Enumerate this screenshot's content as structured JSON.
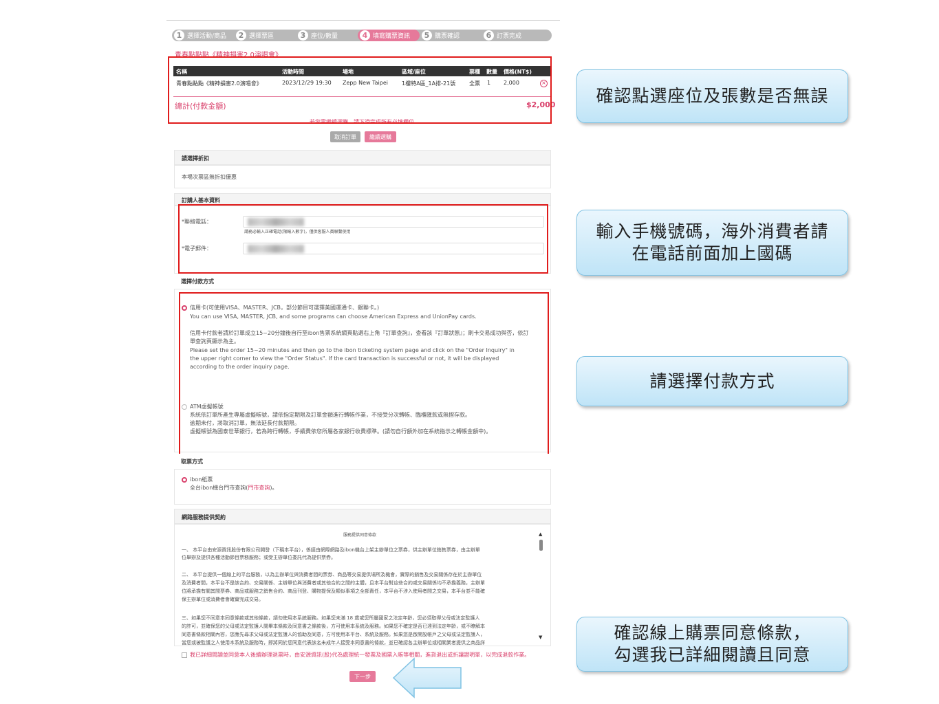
{
  "steps": [
    {
      "num": "1",
      "label": "選擇活動/商品"
    },
    {
      "num": "2",
      "label": "選擇票區"
    },
    {
      "num": "3",
      "label": "座位/數量"
    },
    {
      "num": "4",
      "label": "填寫購票資訊"
    },
    {
      "num": "5",
      "label": "購票確認"
    },
    {
      "num": "6",
      "label": "訂票完成"
    }
  ],
  "event_title": "青春點點點《精神損害2.0演唱會》",
  "order_table": {
    "headers": [
      "名稱",
      "活動時間",
      "場地",
      "區域/座位",
      "票種",
      "數量",
      "價格(NT$)"
    ],
    "row": [
      "青春點點點《精神損害2.0演唱會》",
      "2023/12/29 19:30",
      "Zepp New Taipei",
      "1樓特A區_1A排-21號",
      "全票",
      "1",
      "2,000"
    ]
  },
  "total": {
    "label": "總計(付款金額)",
    "value": "$2,000"
  },
  "notice": "若您需繼續選購，請下滑完成所有必填欄位",
  "buttons": {
    "cancel": "取消訂單",
    "continue": "繼續選購",
    "next": "下一步"
  },
  "discount": {
    "title": "請選擇折扣",
    "text": "本場次票區無折扣優惠"
  },
  "buyer": {
    "title": "訂購人基本資料",
    "phone_label": "*聯絡電話：",
    "phone_hint": "請務必輸入正確電話(限輸入數字)，僅供客服人員聯繫使用",
    "email_label": "*電子郵件："
  },
  "payment": {
    "title": "選擇付款方式",
    "card_label": "信用卡(可使用VISA、MASTER、JCB，部分節目可選擇美國運通卡、銀聯卡。)",
    "card_en": "You can use VISA, MASTER, JCB, and some programs can choose American Express and UnionPay cards.",
    "card_zh_1": "信用卡付款者請於訂單成立15~20分鐘後自行至ibon售票系統網頁點選右上角『訂單查詢』，查看該『訂單狀態』；刷卡交易成功與否，依訂",
    "card_zh_2": "單查詢頁顯示為主。",
    "card_en_2": "Please set the order 15~20 minutes and then go to the ibon ticketing system page and click on the \"Order Inquiry\" in",
    "card_en_3": "the upper right corner to view the \"Order Status\". If the card transaction is successful or not, it will be displayed",
    "card_en_4": "according to the order inquiry page.",
    "atm_label": "ATM虛擬帳號",
    "atm_1": "系統依訂單所產生專屬虛擬帳號，請依指定期限及訂單金額進行轉帳作業，不接受分次轉帳、臨櫃匯款或無摺存款。",
    "atm_2": "逾期未付，將取消訂單，無法延長付款期限。",
    "atm_3": "虛擬帳號為國泰世華銀行，若為跨行轉帳，手續費依您所屬各家銀行收費標準。(請勿自行額外加在系統指示之轉帳金額中)。"
  },
  "pickup": {
    "title": "取票方式",
    "option": "ibon紙票",
    "text_prefix": "全台ibon機台門市查詢(",
    "link": "門市查詢",
    "text_suffix": ")。"
  },
  "terms": {
    "title": "網路服務提供契約",
    "doc_title": "服務提供同意條款",
    "p1_a": "一、 本平台由安源資訊股份有限公司開發（下稱本平台），係經由網際網路及ibon機台上架主辦單位之票券，供主辦單位銷售票券，由主辦單",
    "p1_b": "位舉辦及提供各種活動節目票務服務；或受主辦單位委託代為提供票券。",
    "p2_a": "二、 本平台提供一個線上的平台服務，以為主辦單位與消費者間的票券、商品等交易提供場所及機會，實際的銷售及交易關係存在於主辦單位",
    "p2_b": "及消費者間，本平台不是該合約、交易關係、主辦單位與消費者或其他合約之間的主體，且本平台對這些合約或交易關係均不承擔義務，主辦單",
    "p2_c": "位將承擔有關其間票券、商品或服務之銷售合約、商品刊登、購物提保及類似事項之全部責任，本平台不涉入使用者間之交易，本平台並不能確",
    "p2_d": "保主辦單位或消費者會確實完成交易。",
    "p3_a": "三、如果您不同意本同意條款或其他條款，請勿使用本系統服務。如果您未滿 18 歲或您所屬國家之法定年齡，您必須取得父母或法定監護人",
    "p3_b": "的許可，並確保您的父母或法定監護人閱畢本條款及同意書之條款後，方可使用本系統及服務。如果您不確定是否已達到法定年齡，或不瞭解本",
    "p3_c": "同意書條款相關內容，您應先尋求父母或法定監護人的協助及同意，方可使用本平台、系統及服務。如果您是啟開設帳戶之父母或法定監護人，",
    "p3_d": "當您或被監護之人使用本系統及服務時，即將同於您同意代表該名未成年人接受本同意書的條款，並已確認各主辦單位或相關業者提供之商品詳",
    "agree": "我已詳細閱讀並同意本人後續辦理退票時，由安源資訊(股)代為處理統一發票及國票入帳等相關，進貨退出或折讓證明單，以完成退款作業。"
  },
  "callouts": {
    "c1": "確認點選座位及張數是否無誤",
    "c2_line1": "輸入手機號碼，海外消費者請",
    "c2_line2": "在電話前面加上國碼",
    "c3": "請選擇付款方式",
    "c4_line1": "確認線上購票同意條款，",
    "c4_line2": "勾選我已詳細閱讀且同意"
  },
  "colors": {
    "accent": "#e6799a",
    "red_box": "#e01b1b",
    "callout": "#bfe4f7"
  }
}
